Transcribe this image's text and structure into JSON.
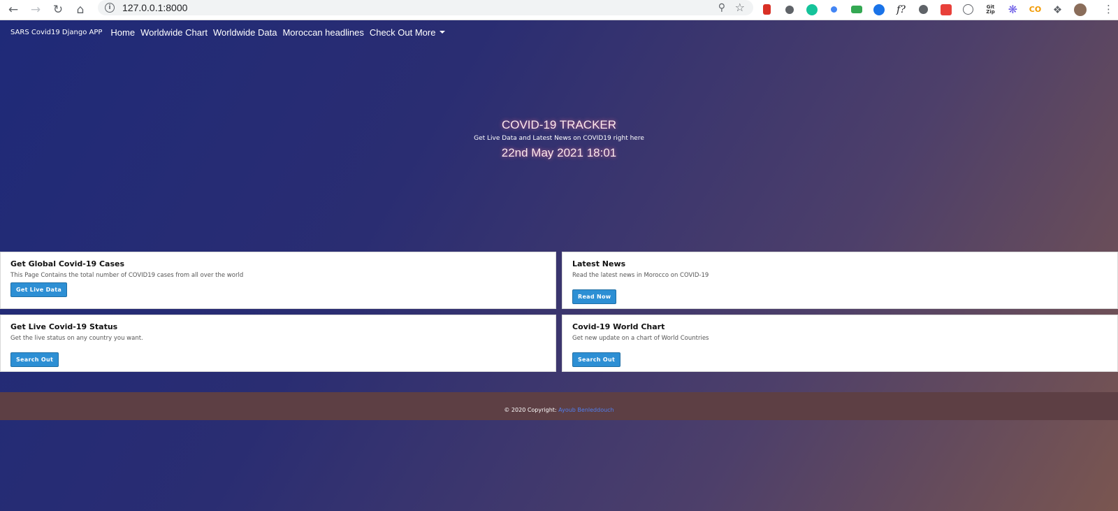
{
  "browser": {
    "url": "127.0.0.1:8000",
    "icons": [
      "back-icon",
      "forward-icon",
      "reload-icon",
      "home-icon",
      "info-icon",
      "zoom-icon",
      "star-icon",
      "menu-icon"
    ],
    "extension_colors": [
      "#d93025",
      "#5f6368",
      "#15c39a",
      "#4285f4",
      "#34a853",
      "#1a73e8",
      "#202124",
      "#5f6368",
      "#e8403a",
      "#5f6368",
      "#333333",
      "#6c5ce7",
      "#f29900",
      "#5f6368",
      "#8a6d5a"
    ],
    "extension_labels": {
      "f": "f?",
      "git": "Git\nZip",
      "co": "CO"
    }
  },
  "navbar": {
    "brand": "SARS Covid19 Django APP",
    "links": [
      "Home",
      "Worldwide Chart",
      "Worldwide Data",
      "Moroccan headlines",
      "Check Out More"
    ]
  },
  "hero": {
    "title": "COVID-19 TRACKER",
    "subtitle": "Get Live Data and Latest News on COVID19 right here",
    "date": "22nd May 2021 18:01"
  },
  "cards": [
    {
      "title": "Get Global Covid-19 Cases",
      "text": "This Page Contains the total number of COVID19 cases from all over the world",
      "button": "Get Live Data"
    },
    {
      "title": "Latest News",
      "text": "Read the latest news in Morocco on COVID-19",
      "button": "Read Now"
    },
    {
      "title": "Get Live Covid-19 Status",
      "text": "Get the live status on any country you want.",
      "button": "Search Out"
    },
    {
      "title": "Covid-19 World Chart",
      "text": "Get new update on a chart of World Countries",
      "button": "Search Out"
    }
  ],
  "footer": {
    "copyright": "© 2020 Copyright:",
    "author": "Ayoub Benleddouch"
  },
  "colors": {
    "accent": "#2d8fd4",
    "footer_bg": "#5d3f44",
    "link": "#4f7ef0"
  }
}
